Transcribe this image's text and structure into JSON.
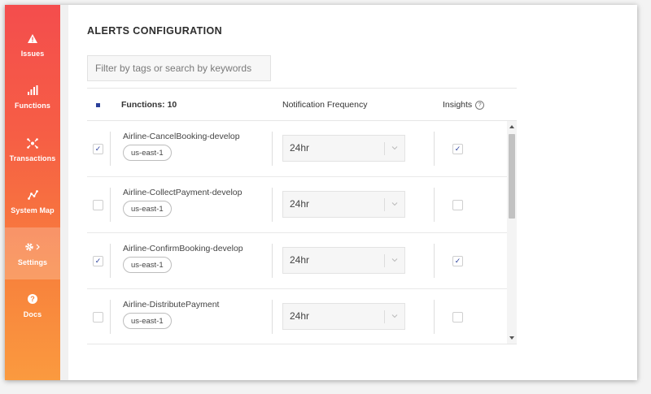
{
  "sidebar": {
    "items": [
      {
        "label": "Issues",
        "icon": "warning-icon"
      },
      {
        "label": "Functions",
        "icon": "bar-chart-icon"
      },
      {
        "label": "Transactions",
        "icon": "transactions-icon"
      },
      {
        "label": "System Map",
        "icon": "system-map-icon"
      },
      {
        "label": "Settings",
        "icon": "gear-icon",
        "active": true
      },
      {
        "label": "Docs",
        "icon": "help-circle-icon"
      }
    ]
  },
  "main": {
    "title": "ALERTS CONFIGURATION",
    "search": {
      "placeholder": "Filter by tags or search by keywords",
      "value": ""
    },
    "table": {
      "headers": {
        "functions": "Functions: 10",
        "frequency": "Notification Frequency",
        "insights": "Insights"
      },
      "rows": [
        {
          "name": "Airline-CancelBooking-develop",
          "region": "us-east-1",
          "selected": true,
          "frequency": "24hr",
          "insights": true
        },
        {
          "name": "Airline-CollectPayment-develop",
          "region": "us-east-1",
          "selected": false,
          "frequency": "24hr",
          "insights": false
        },
        {
          "name": "Airline-ConfirmBooking-develop",
          "region": "us-east-1",
          "selected": true,
          "frequency": "24hr",
          "insights": true
        },
        {
          "name": "Airline-DistributePayment",
          "region": "us-east-1",
          "selected": false,
          "frequency": "24hr",
          "insights": false
        }
      ]
    }
  },
  "colors": {
    "sidebar_top": "#f44d4d",
    "sidebar_bottom": "#fa9a3f",
    "checkbox_accent": "#2a3f9a"
  }
}
